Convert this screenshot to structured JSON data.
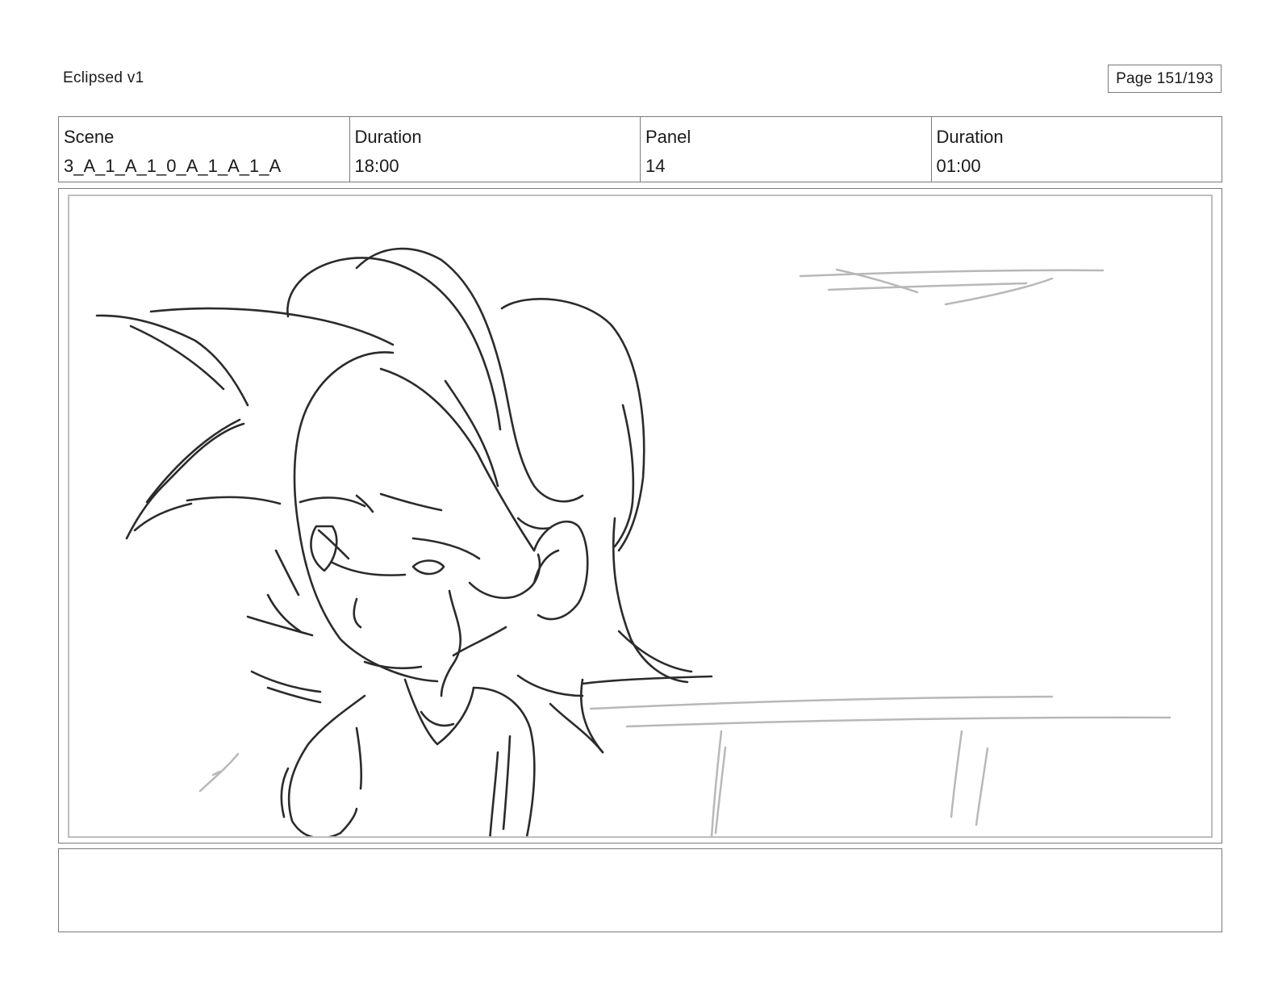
{
  "header": {
    "title": "Eclipsed v1",
    "page": "Page 151/193"
  },
  "info": {
    "scene_label": "Scene",
    "scene_value": "3_A_1_A_1_0_A_1_A_1_A",
    "scene_duration_label": "Duration",
    "scene_duration_value": "18:00",
    "panel_label": "Panel",
    "panel_value": "14",
    "panel_duration_label": "Duration",
    "panel_duration_value": "01:00"
  },
  "notes": {
    "text": ""
  }
}
